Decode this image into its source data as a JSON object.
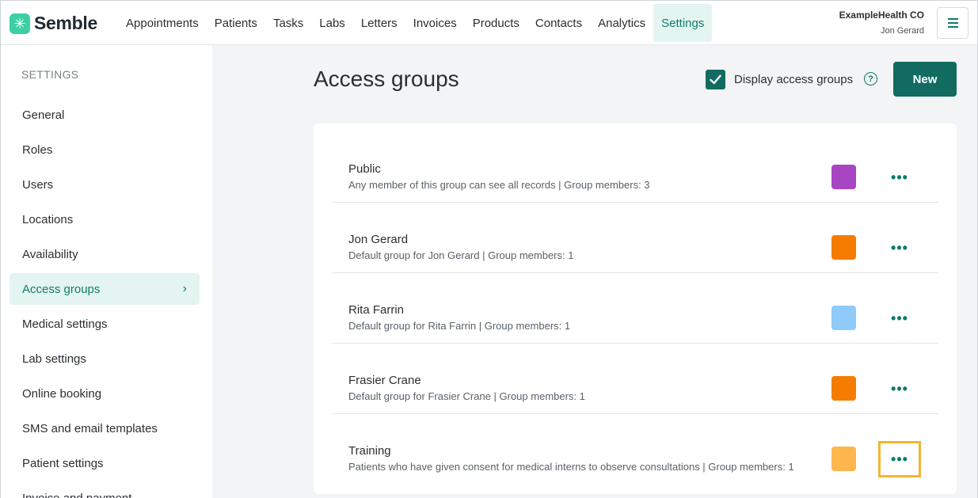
{
  "brand": {
    "name": "Semble",
    "logo_glyph": "✳"
  },
  "nav": [
    {
      "label": "Appointments",
      "name": "appointments"
    },
    {
      "label": "Patients",
      "name": "patients"
    },
    {
      "label": "Tasks",
      "name": "tasks"
    },
    {
      "label": "Labs",
      "name": "labs"
    },
    {
      "label": "Letters",
      "name": "letters"
    },
    {
      "label": "Invoices",
      "name": "invoices"
    },
    {
      "label": "Products",
      "name": "products"
    },
    {
      "label": "Contacts",
      "name": "contacts"
    },
    {
      "label": "Analytics",
      "name": "analytics"
    },
    {
      "label": "Settings",
      "name": "settings",
      "active": true
    }
  ],
  "account": {
    "org": "ExampleHealth CO",
    "user": "Jon Gerard",
    "menu_icon": "hamburger-icon"
  },
  "sidebar": {
    "heading": "SETTINGS",
    "items": [
      {
        "label": "General"
      },
      {
        "label": "Roles"
      },
      {
        "label": "Users"
      },
      {
        "label": "Locations"
      },
      {
        "label": "Availability"
      },
      {
        "label": "Access groups",
        "active": true
      },
      {
        "label": "Medical settings"
      },
      {
        "label": "Lab settings"
      },
      {
        "label": "Online booking"
      },
      {
        "label": "SMS and email templates"
      },
      {
        "label": "Patient settings"
      },
      {
        "label": "Invoice and payment"
      }
    ]
  },
  "main": {
    "title": "Access groups",
    "display_toggle": {
      "label": "Display access groups",
      "checked": true
    },
    "help_glyph": "?",
    "new_label": "New",
    "more_glyph": "•••",
    "groups": [
      {
        "name": "Public",
        "description": "Any member of this group can see all records | Group members: 3",
        "color": "#a845c2"
      },
      {
        "name": "Jon Gerard",
        "description": "Default group for Jon Gerard | Group members: 1",
        "color": "#f57c00"
      },
      {
        "name": "Rita Farrin",
        "description": "Default group for Rita Farrin | Group members: 1",
        "color": "#90caf9"
      },
      {
        "name": "Frasier Crane",
        "description": "Default group for Frasier Crane | Group members: 1",
        "color": "#f57c00"
      },
      {
        "name": "Training",
        "description": "Patients who have given consent for medical interns to observe consultations | Group members: 1",
        "color": "#ffb74d",
        "highlighted": true
      }
    ]
  },
  "colors": {
    "accent": "#126b60",
    "accent_light": "#e4f5f1",
    "highlight": "#f2b630"
  }
}
